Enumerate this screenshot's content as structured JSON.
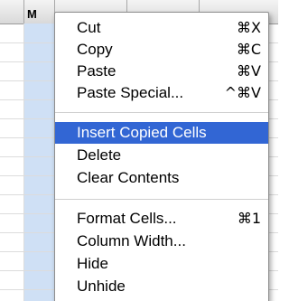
{
  "spreadsheet": {
    "column_header_visible": "M"
  },
  "menu": {
    "groups": [
      {
        "items": [
          {
            "label": "Cut",
            "shortcut": "⌘X"
          },
          {
            "label": "Copy",
            "shortcut": "⌘C"
          },
          {
            "label": "Paste",
            "shortcut": "⌘V"
          },
          {
            "label": "Paste Special...",
            "shortcut": "^⌘V"
          }
        ]
      },
      {
        "items": [
          {
            "label": "Insert Copied Cells",
            "shortcut": "",
            "highlighted": true
          },
          {
            "label": "Delete",
            "shortcut": ""
          },
          {
            "label": "Clear Contents",
            "shortcut": ""
          }
        ]
      },
      {
        "items": [
          {
            "label": "Format Cells...",
            "shortcut": "⌘1"
          },
          {
            "label": "Column Width...",
            "shortcut": ""
          },
          {
            "label": "Hide",
            "shortcut": ""
          },
          {
            "label": "Unhide",
            "shortcut": ""
          }
        ]
      }
    ],
    "highlight_color": "#3266d4"
  }
}
